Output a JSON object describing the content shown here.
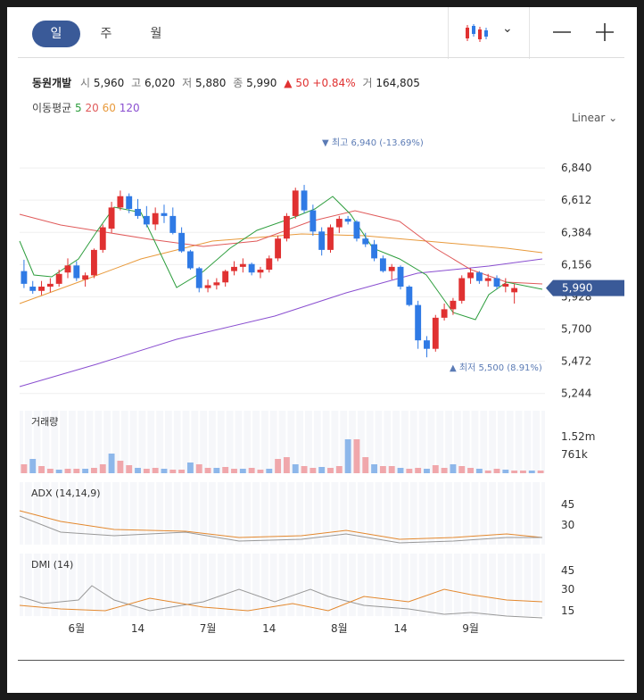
{
  "tabs": [
    {
      "label": "일",
      "active": true
    },
    {
      "label": "주",
      "active": false
    },
    {
      "label": "월",
      "active": false
    }
  ],
  "quote": {
    "name": "동원개발",
    "open_label": "시",
    "open": "5,960",
    "high_label": "고",
    "high": "6,020",
    "low_label": "저",
    "low": "5,880",
    "close_label": "종",
    "close": "5,990",
    "change_arrow": "▲",
    "change": "50",
    "change_pct": "+0.84%",
    "volume_label": "거",
    "volume": "164,805"
  },
  "ma": {
    "label": "이동평균",
    "periods": [
      {
        "p": "5",
        "color": "#2e9e3e"
      },
      {
        "p": "20",
        "color": "#e05a5a"
      },
      {
        "p": "60",
        "color": "#e89a3c"
      },
      {
        "p": "120",
        "color": "#8a4fd0"
      }
    ]
  },
  "scale_label": "Linear",
  "colors": {
    "up": "#e03131",
    "down": "#2f7ae5",
    "accent": "#3a5a98"
  },
  "chart_data": {
    "type": "candlestick",
    "price_ticks": [
      6840,
      6612,
      6384,
      6156,
      5928,
      5700,
      5472,
      5244
    ],
    "ylim": [
      5160,
      7030
    ],
    "current_price": "5,990",
    "high_annotation": "▼ 최고 6,940 (-13.69%)",
    "low_annotation": "▲ 최저 5,500 (8.91%)",
    "x_ticks": [
      {
        "label": "6월",
        "i": 6
      },
      {
        "label": "14",
        "i": 13
      },
      {
        "label": "7월",
        "i": 21
      },
      {
        "label": "14",
        "i": 28
      },
      {
        "label": "8월",
        "i": 36
      },
      {
        "label": "14",
        "i": 43
      },
      {
        "label": "9월",
        "i": 51
      }
    ],
    "candles": [
      [
        6110,
        6190,
        5990,
        6020
      ],
      [
        6000,
        6040,
        5950,
        5970
      ],
      [
        5970,
        6040,
        5940,
        6000
      ],
      [
        6000,
        6060,
        5960,
        6020
      ],
      [
        6020,
        6120,
        6000,
        6090
      ],
      [
        6100,
        6200,
        6060,
        6150
      ],
      [
        6150,
        6180,
        6040,
        6060
      ],
      [
        6050,
        6100,
        6000,
        6080
      ],
      [
        6080,
        6270,
        6060,
        6260
      ],
      [
        6260,
        6440,
        6240,
        6420
      ],
      [
        6410,
        6600,
        6380,
        6560
      ],
      [
        6560,
        6680,
        6540,
        6640
      ],
      [
        6640,
        6660,
        6520,
        6550
      ],
      [
        6550,
        6620,
        6480,
        6500
      ],
      [
        6500,
        6570,
        6420,
        6440
      ],
      [
        6440,
        6560,
        6400,
        6520
      ],
      [
        6520,
        6580,
        6450,
        6500
      ],
      [
        6500,
        6560,
        6370,
        6380
      ],
      [
        6380,
        6420,
        6240,
        6250
      ],
      [
        6250,
        6260,
        6120,
        6130
      ],
      [
        6130,
        6140,
        5960,
        5990
      ],
      [
        5990,
        6050,
        5960,
        6010
      ],
      [
        6010,
        6060,
        5980,
        6030
      ],
      [
        6030,
        6120,
        6000,
        6110
      ],
      [
        6110,
        6180,
        6080,
        6140
      ],
      [
        6140,
        6200,
        6100,
        6160
      ],
      [
        6160,
        6170,
        6080,
        6100
      ],
      [
        6100,
        6140,
        6060,
        6120
      ],
      [
        6120,
        6220,
        6100,
        6200
      ],
      [
        6200,
        6360,
        6180,
        6340
      ],
      [
        6340,
        6520,
        6320,
        6500
      ],
      [
        6500,
        6700,
        6480,
        6680
      ],
      [
        6680,
        6720,
        6520,
        6540
      ],
      [
        6540,
        6580,
        6360,
        6390
      ],
      [
        6390,
        6420,
        6220,
        6260
      ],
      [
        6260,
        6440,
        6240,
        6420
      ],
      [
        6420,
        6500,
        6380,
        6480
      ]
    ]
  },
  "panels": {
    "volume": {
      "title": "거래량",
      "ticks": [
        "1.52m",
        "761k"
      ]
    },
    "adx": {
      "title": "ADX (14,14,9)",
      "ticks": [
        "45",
        "30"
      ]
    },
    "dmi": {
      "title": "DMI (14)",
      "ticks": [
        "45",
        "30",
        "15"
      ]
    }
  }
}
